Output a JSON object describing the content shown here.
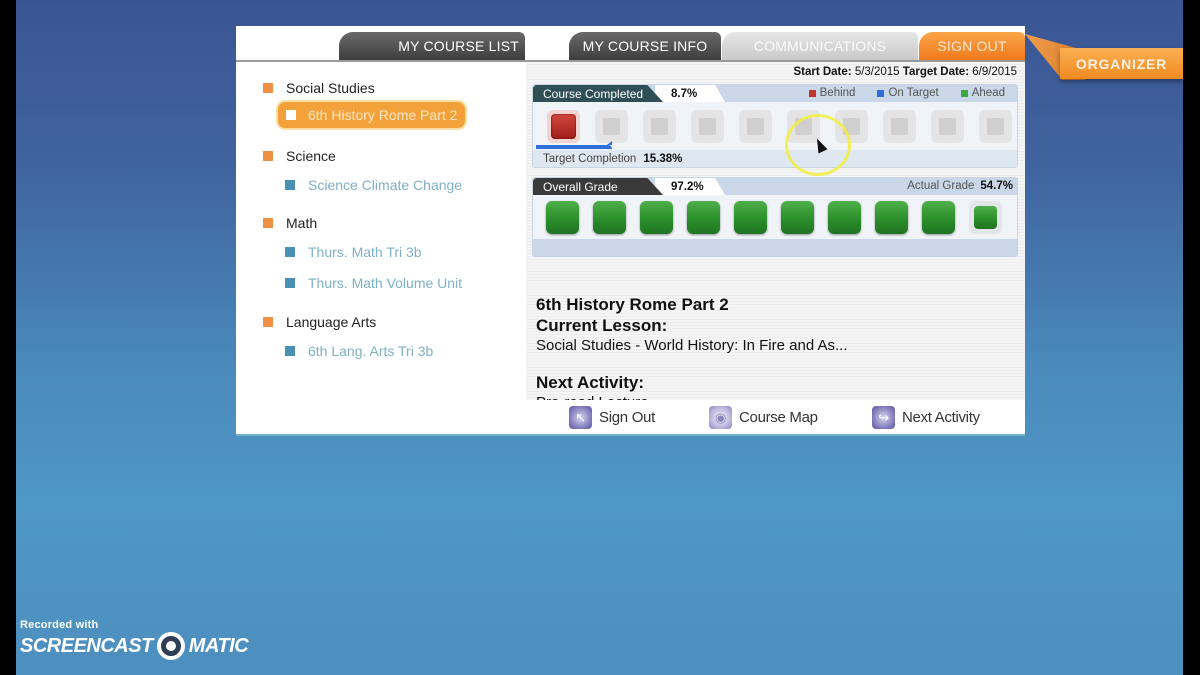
{
  "tabs": {
    "my_course_list": "MY COURSE LIST",
    "my_course_info": "MY COURSE INFO",
    "communications": "COMMUNICATIONS",
    "sign_out": "SIGN OUT",
    "organizer": "ORGANIZER"
  },
  "course_list": {
    "categories": [
      {
        "label": "Social Studies",
        "courses": [
          {
            "label": "6th History Rome Part 2",
            "active": true
          }
        ]
      },
      {
        "label": "Science",
        "courses": [
          {
            "label": "Science Climate Change"
          }
        ]
      },
      {
        "label": "Math",
        "courses": [
          {
            "label": "Thurs. Math Tri 3b"
          },
          {
            "label": "Thurs. Math Volume Unit"
          }
        ]
      },
      {
        "label": "Language Arts",
        "courses": [
          {
            "label": "6th Lang. Arts Tri 3b"
          }
        ]
      }
    ]
  },
  "info": {
    "start_date_label": "Start Date:",
    "start_date": "5/3/2015",
    "target_date_label": "Target Date:",
    "target_date": "6/9/2015",
    "course_completed": {
      "label": "Course Completed",
      "value": "8.7%",
      "legend": {
        "behind": "Behind",
        "on_target": "On Target",
        "ahead": "Ahead"
      },
      "legend_colors": {
        "behind": "#c0332e",
        "on_target": "#2f6fdb",
        "ahead": "#3da83d"
      },
      "segments_total": 10,
      "segments_status": [
        "behind",
        "empty",
        "empty",
        "empty",
        "empty",
        "empty",
        "empty",
        "empty",
        "empty",
        "empty"
      ],
      "target_completion_label": "Target Completion",
      "target_completion_value": "15.38%"
    },
    "overall_grade": {
      "label": "Overall Grade",
      "value": "97.2%",
      "actual_grade_label": "Actual Grade",
      "actual_grade_value": "54.7%",
      "segments_total": 10,
      "segments_filled": 10,
      "last_segment_partial": true
    },
    "course_title": "6th History Rome Part 2",
    "current_lesson_label": "Current Lesson:",
    "current_lesson": "Social Studies - World History: In Fire and As...",
    "next_activity_label": "Next Activity:",
    "next_activity": "Pre-read Lecture"
  },
  "footer": {
    "sign_out": "Sign Out",
    "course_map": "Course Map",
    "next_activity": "Next Activity"
  },
  "watermark": {
    "top": "Recorded with",
    "left": "SCREENCAST",
    "right": "MATIC"
  }
}
